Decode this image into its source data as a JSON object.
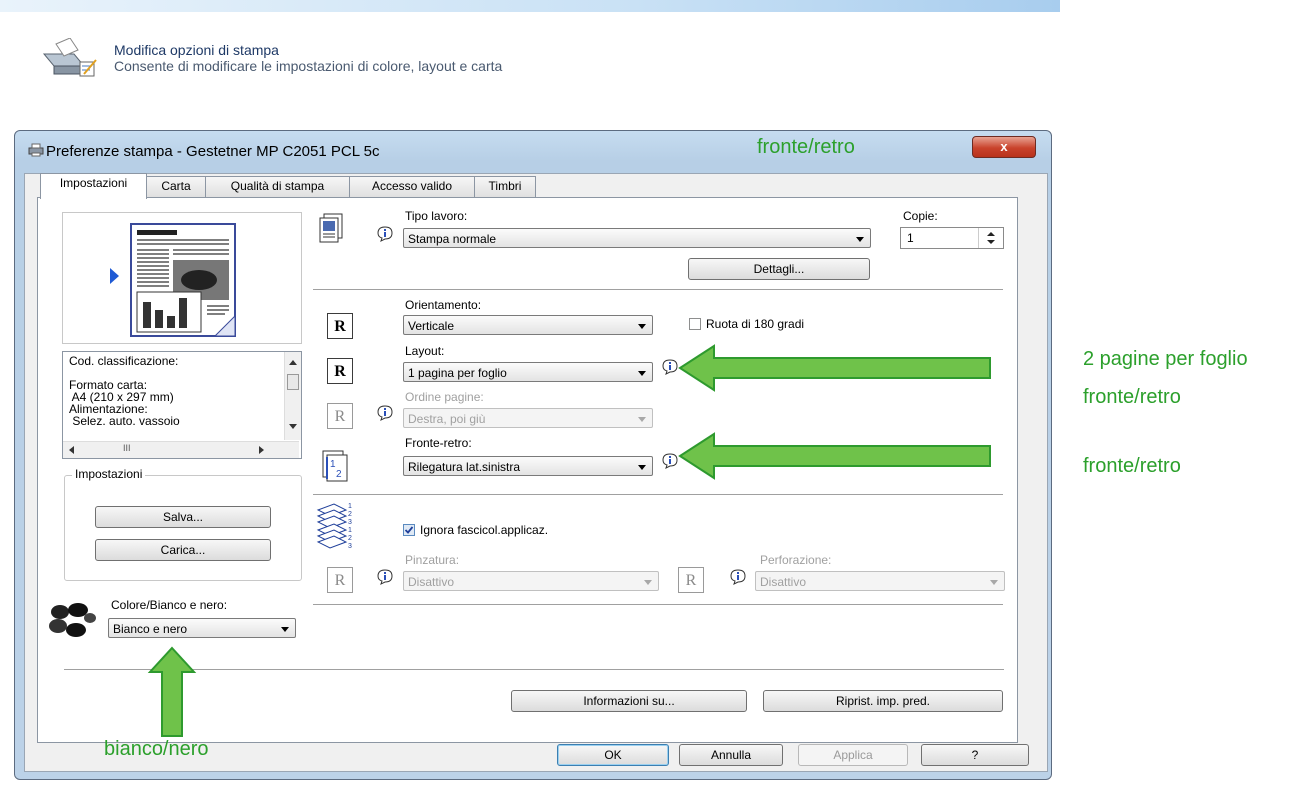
{
  "header": {
    "title": "Modifica opzioni di stampa",
    "subtitle": "Consente di modificare le impostazioni di colore, layout e carta"
  },
  "window": {
    "title": "Preferenze stampa - Gestetner MP C2051 PCL 5c",
    "close_label": "x"
  },
  "tabs": [
    "Impostazioni",
    "Carta",
    "Qualità di stampa",
    "Accesso valido",
    "Timbri"
  ],
  "active_tab": "Impostazioni",
  "summary_list": {
    "lines": [
      "Cod. classificazione:",
      "",
      "Formato carta:",
      " A4 (210 x 297 mm)",
      "Alimentazione:",
      " Selez. auto. vassoio"
    ],
    "scroll_mid": "III"
  },
  "settings_group": {
    "title": "Impostazioni",
    "save_label": "Salva...",
    "load_label": "Carica..."
  },
  "color": {
    "label": "Colore/Bianco e nero:",
    "value": "Bianco e nero"
  },
  "job": {
    "type_label": "Tipo lavoro:",
    "type_value": "Stampa normale",
    "copies_label": "Copie:",
    "copies_value": "1",
    "details_label": "Dettagli..."
  },
  "layout": {
    "orientation_label": "Orientamento:",
    "orientation_value": "Verticale",
    "rotate_label": "Ruota di 180 gradi",
    "layout_label": "Layout:",
    "layout_value": "1 pagina per foglio",
    "page_order_label": "Ordine pagine:",
    "page_order_value": "Destra, poi giù",
    "duplex_label": "Fronte-retro:",
    "duplex_value": "Rilegatura lat.sinistra",
    "r_glyph": "R"
  },
  "finishing": {
    "ignore_collate_label": "Ignora fascicol.applicaz.",
    "ignore_collate_checked": true,
    "staple_label": "Pinzatura:",
    "staple_value": "Disattivo",
    "punch_label": "Perforazione:",
    "punch_value": "Disattivo"
  },
  "buttons": {
    "info": "Informazioni su...",
    "restore": "Riprist. imp. pred.",
    "ok": "OK",
    "cancel": "Annulla",
    "apply": "Applica",
    "help": "?"
  },
  "annotations": {
    "top": "fronte/retro",
    "right_1": "2 pagine per foglio",
    "right_2": "fronte/retro",
    "right_3": "fronte/retro",
    "bottom": "bianco/nero",
    "arrow_color": "#6fc24a"
  },
  "preview_text": "PRINTERISK"
}
